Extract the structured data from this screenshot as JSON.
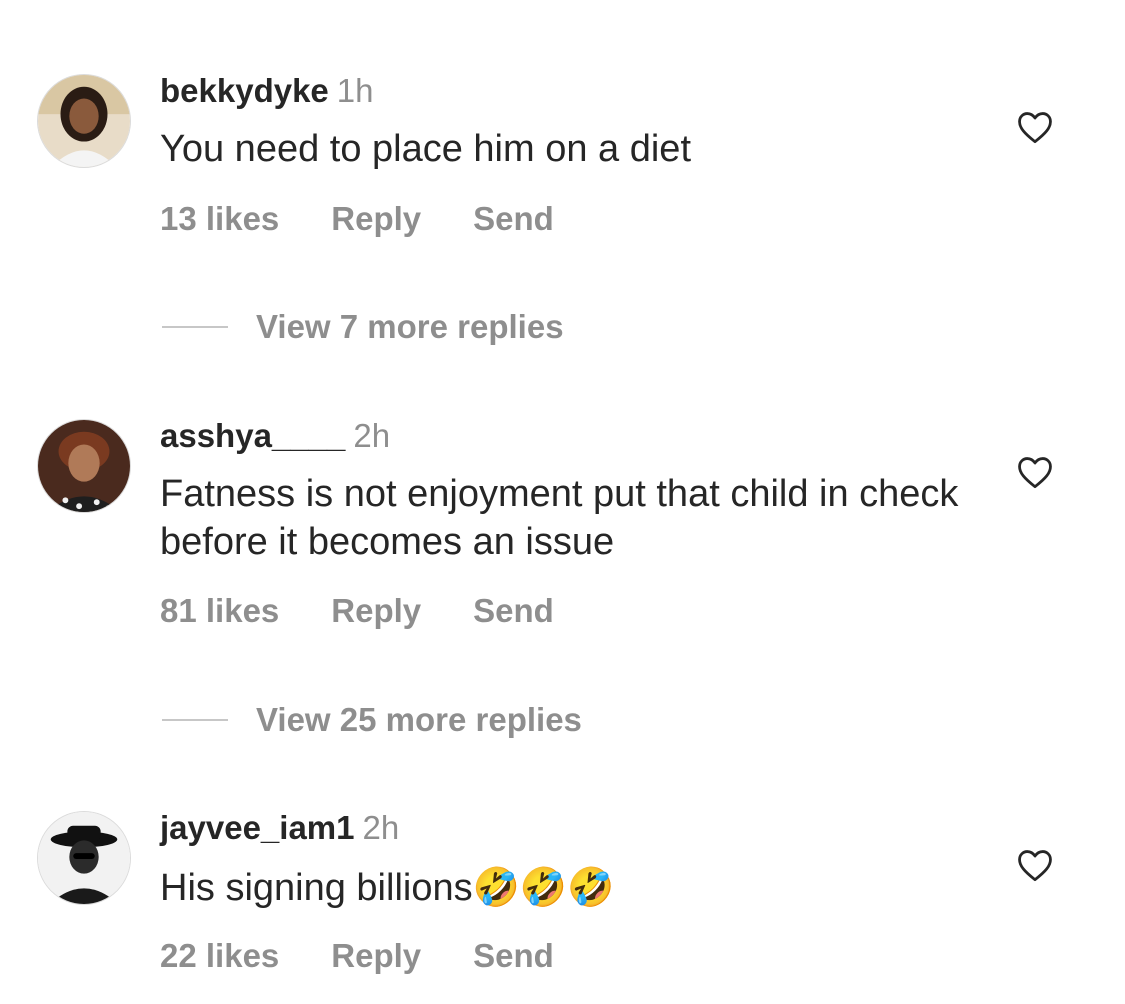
{
  "comments": [
    {
      "username": "bekkydyke",
      "time": "1h",
      "text": "You need to place him on a diet",
      "emojis": "",
      "likes": "13 likes",
      "reply_label": "Reply",
      "send_label": "Send",
      "view_replies": "View 7 more replies"
    },
    {
      "username": "asshya____",
      "time": "2h",
      "text": "Fatness is not enjoyment put that child in check before it becomes an issue",
      "emojis": "",
      "likes": "81 likes",
      "reply_label": "Reply",
      "send_label": "Send",
      "view_replies": "View 25 more replies"
    },
    {
      "username": "jayvee_iam1",
      "time": "2h",
      "text": "His signing billions",
      "emojis": "🤣🤣🤣",
      "likes": "22 likes",
      "reply_label": "Reply",
      "send_label": "Send",
      "view_replies": ""
    }
  ],
  "icons": {
    "like": "heart-outline-icon",
    "line": "divider-line"
  },
  "colors": {
    "text": "#262626",
    "secondary": "#8e8e8e",
    "divider": "#c7c7c7"
  }
}
